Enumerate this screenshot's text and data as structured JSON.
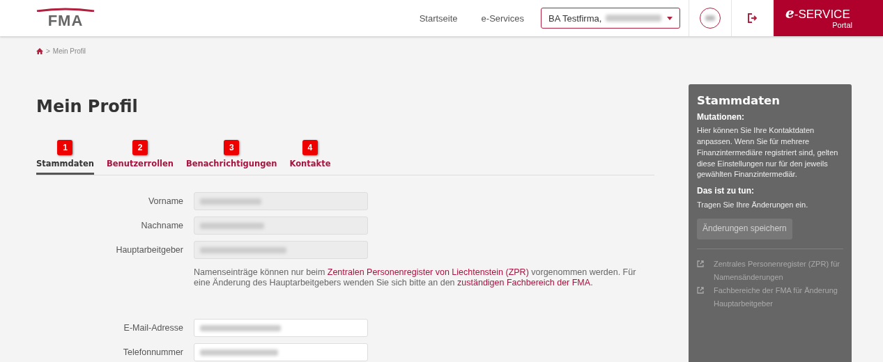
{
  "header": {
    "logo": "FMA",
    "nav": [
      "Startseite",
      "e-Services"
    ],
    "company_select": {
      "value": "BA Testfirma,"
    },
    "brand": {
      "title": "-SERVICE",
      "prefix": "e",
      "subtitle": "Portal"
    }
  },
  "breadcrumb": {
    "separator": ">",
    "items": [
      "Mein Profil"
    ]
  },
  "page_title": "Mein Profil",
  "tabs": [
    {
      "number": "1",
      "label": "Stammdaten",
      "selected": true
    },
    {
      "number": "2",
      "label": "Benutzerrollen",
      "selected": false
    },
    {
      "number": "3",
      "label": "Benachrichtigungen",
      "selected": false
    },
    {
      "number": "4",
      "label": "Kontakte",
      "selected": false
    }
  ],
  "form": {
    "fields": [
      {
        "label": "Vorname",
        "disabled": true
      },
      {
        "label": "Nachname",
        "disabled": true
      },
      {
        "label": "Hauptarbeitgeber",
        "disabled": true
      }
    ],
    "note": [
      {
        "kind": "text",
        "text": "Namenseinträge können nur beim "
      },
      {
        "kind": "link",
        "text": "Zentralen Personenregister von Liechtenstein (ZPR)"
      },
      {
        "kind": "text",
        "text": " vorgenommen werden. Für eine Änderung des Hauptarbeitgebers wenden Sie sich bitte an den "
      },
      {
        "kind": "link",
        "text": "zuständigen Fachbereich der FMA"
      },
      {
        "kind": "text",
        "text": "."
      }
    ],
    "contact_fields": [
      {
        "label": "E-Mail-Adresse",
        "disabled": false
      },
      {
        "label": "Telefonnummer",
        "disabled": false
      }
    ]
  },
  "info_panel": {
    "title": "Stammdaten",
    "sections": [
      {
        "heading": "Mutationen:",
        "text": "Hier können Sie Ihre Kontaktdaten anpassen. Wenn Sie für mehrere Finanzintermediäre registriert sind, gelten diese Einstellungen nur für den jeweils gewählten Finanzintermediär."
      },
      {
        "heading": "Das ist zu tun:",
        "text": "Tragen Sie Ihre Änderungen ein."
      }
    ],
    "save_button": {
      "label": "Änderungen speichern",
      "disabled": true
    },
    "links": [
      "Zentrales Personenregister (ZPR) für Namensänderungen",
      "Fachbereiche der FMA für Änderung Hauptarbeitgeber"
    ]
  }
}
